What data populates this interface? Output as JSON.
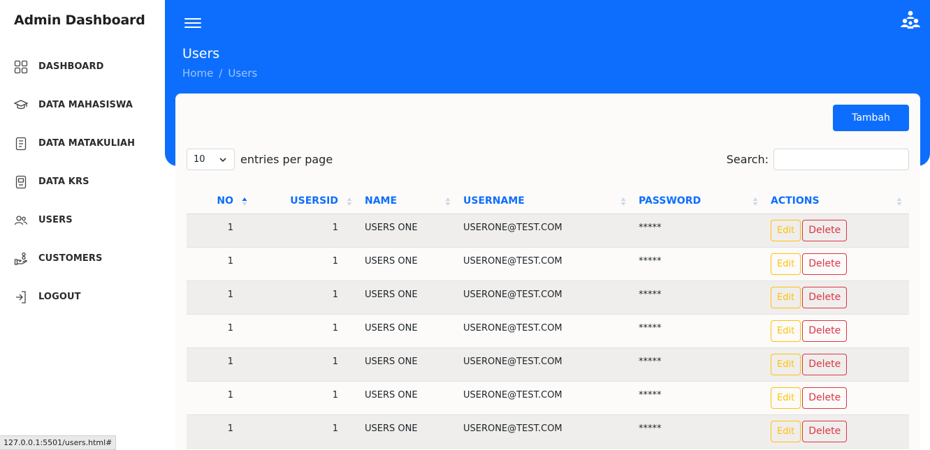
{
  "brand": "Admin Dashboard",
  "sidebar": {
    "items": [
      {
        "label": "DASHBOARD",
        "icon": "grid-icon"
      },
      {
        "label": "DATA MAHASISWA",
        "icon": "graduation-cap-icon"
      },
      {
        "label": "DATA MATAKULIAH",
        "icon": "document-list-icon"
      },
      {
        "label": "DATA KRS",
        "icon": "document-icon"
      },
      {
        "label": "USERS",
        "icon": "users-icon"
      },
      {
        "label": "CUSTOMERS",
        "icon": "hand-coins-icon"
      },
      {
        "label": "LOGOUT",
        "icon": "logout-icon"
      }
    ]
  },
  "header": {
    "title": "Users",
    "breadcrumb": [
      "Home",
      "Users"
    ],
    "accent_color": "#0d6efd"
  },
  "toolbar": {
    "add_label": "Tambah",
    "entries_value": "10",
    "entries_label": "entries per page",
    "search_label": "Search:",
    "search_value": ""
  },
  "table": {
    "columns": [
      "NO",
      "USERSID",
      "NAME",
      "USERNAME",
      "PASSWORD",
      "ACTIONS"
    ],
    "edit_label": "Edit",
    "delete_label": "Delete",
    "rows": [
      {
        "no": "1",
        "usersid": "1",
        "name": "USERS ONE",
        "username": "USERONE@TEST.COM",
        "password": "*****"
      },
      {
        "no": "1",
        "usersid": "1",
        "name": "USERS ONE",
        "username": "USERONE@TEST.COM",
        "password": "*****"
      },
      {
        "no": "1",
        "usersid": "1",
        "name": "USERS ONE",
        "username": "USERONE@TEST.COM",
        "password": "*****"
      },
      {
        "no": "1",
        "usersid": "1",
        "name": "USERS ONE",
        "username": "USERONE@TEST.COM",
        "password": "*****"
      },
      {
        "no": "1",
        "usersid": "1",
        "name": "USERS ONE",
        "username": "USERONE@TEST.COM",
        "password": "*****"
      },
      {
        "no": "1",
        "usersid": "1",
        "name": "USERS ONE",
        "username": "USERONE@TEST.COM",
        "password": "*****"
      },
      {
        "no": "1",
        "usersid": "1",
        "name": "USERS ONE",
        "username": "USERONE@TEST.COM",
        "password": "*****"
      }
    ]
  },
  "status_bar": "127.0.0.1:5501/users.html#"
}
